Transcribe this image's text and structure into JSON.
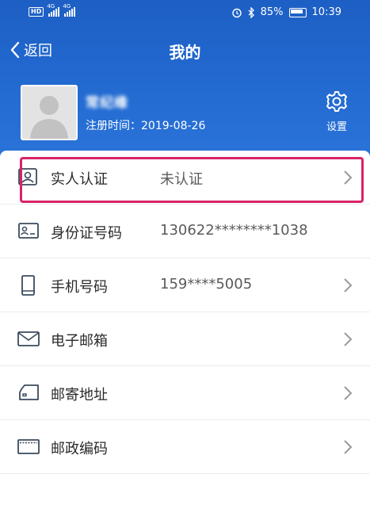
{
  "status_bar": {
    "hd_label": "HD",
    "signal1_label": "4G",
    "signal2_label": "4G",
    "battery_percent": "85%",
    "time": "10:39"
  },
  "nav": {
    "back_label": "返回",
    "title": "我的"
  },
  "profile": {
    "name": "常纪缘",
    "reg_label": "注册时间：",
    "reg_date": "2019-08-26",
    "settings_label": "设置"
  },
  "rows": [
    {
      "icon": "person-card-icon",
      "label": "实人认证",
      "value": "未认证",
      "has_chevron": true
    },
    {
      "icon": "id-card-icon",
      "label": "身份证号码",
      "value": "130622********1038",
      "has_chevron": false
    },
    {
      "icon": "phone-icon",
      "label": "手机号码",
      "value": "159****5005",
      "has_chevron": true
    },
    {
      "icon": "mail-icon",
      "label": "电子邮箱",
      "value": "",
      "has_chevron": true
    },
    {
      "icon": "truck-icon",
      "label": "邮寄地址",
      "value": "",
      "has_chevron": true
    },
    {
      "icon": "postcode-icon",
      "label": "邮政编码",
      "value": "",
      "has_chevron": true
    }
  ],
  "colors": {
    "header_blue": "#236ad1",
    "highlight": "#d8236a",
    "icon_dark": "#3a4a5c"
  }
}
